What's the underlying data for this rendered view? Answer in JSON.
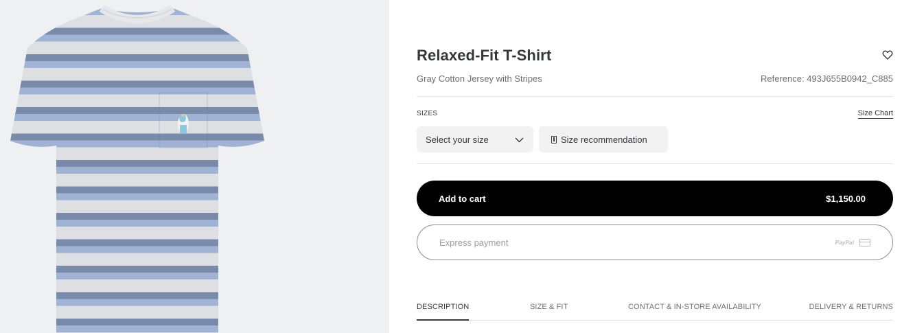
{
  "product": {
    "title": "Relaxed-Fit T-Shirt",
    "subtitle": "Gray Cotton Jersey with Stripes",
    "reference": "Reference: 493J655B0942_C885"
  },
  "sizes": {
    "label": "SIZES",
    "size_chart_link": "Size Chart",
    "select_placeholder": "Select your size",
    "recommendation_label": "Size recommendation"
  },
  "cart": {
    "add_label": "Add to cart",
    "price": "$1,150.00"
  },
  "express": {
    "label": "Express payment",
    "paypal": "PayPal"
  },
  "tabs": [
    "DESCRIPTION",
    "SIZE & FIT",
    "CONTACT & IN-STORE AVAILABILITY",
    "DELIVERY & RETURNS"
  ],
  "icons": {
    "favorite": "heart-icon",
    "select": "chevron-down-icon",
    "recommendation": "ruler-icon",
    "card": "credit-card-icon"
  },
  "colors": {
    "stripe_dark": "#7d8fb0",
    "stripe_light_blue": "#a7b9dc",
    "stripe_white": "#e6e7ea",
    "button": "#000000"
  }
}
